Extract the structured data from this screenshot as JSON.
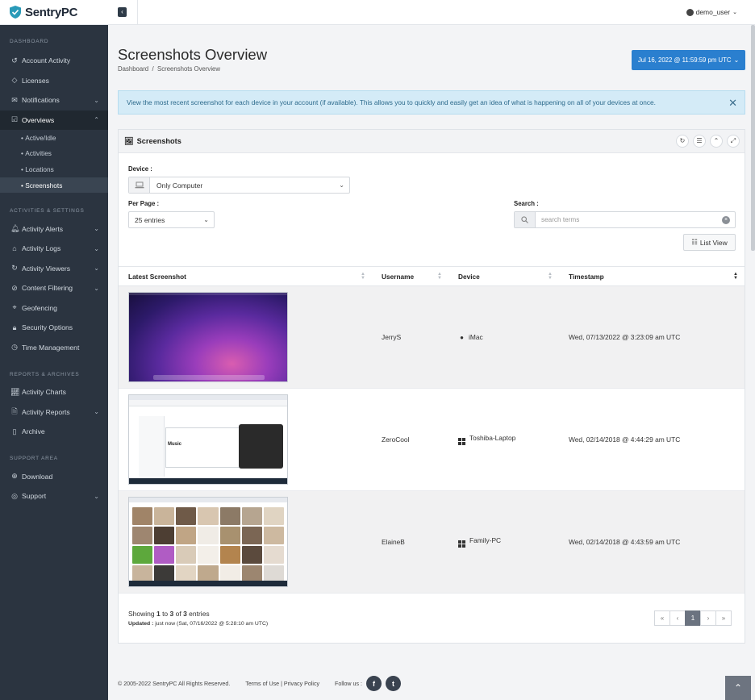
{
  "app": {
    "name": "SentryPC"
  },
  "header": {
    "username": "demo_user"
  },
  "sidebar": {
    "sections": [
      {
        "title": "DASHBOARD"
      },
      {
        "title": "ACTIVITIES & SETTINGS"
      },
      {
        "title": "REPORTS & ARCHIVES"
      },
      {
        "title": "SUPPORT AREA"
      }
    ],
    "items": {
      "account_activity": "Account Activity",
      "licenses": "Licenses",
      "notifications": "Notifications",
      "overviews": "Overviews",
      "active_idle": "Active/Idle",
      "activities": "Activities",
      "locations": "Locations",
      "screenshots": "Screenshots",
      "activity_alerts": "Activity Alerts",
      "activity_logs": "Activity Logs",
      "activity_viewers": "Activity Viewers",
      "content_filtering": "Content Filtering",
      "geofencing": "Geofencing",
      "security_options": "Security Options",
      "time_management": "Time Management",
      "activity_charts": "Activity Charts",
      "activity_reports": "Activity Reports",
      "archive": "Archive",
      "download": "Download",
      "support": "Support"
    }
  },
  "page": {
    "title": "Screenshots Overview",
    "breadcrumb": {
      "home": "Dashboard",
      "separator": "/",
      "current": "Screenshots Overview"
    },
    "date_button": "Jul 16, 2022 @ 11:59:59 pm UTC",
    "alert": "View the most recent screenshot for each device in your account (if available).  This allows you to quickly and easily get an idea of what is happening on all of your devices at once."
  },
  "card": {
    "title": "Screenshots",
    "device_label": "Device :",
    "device_value": "Only Computer",
    "per_page_label": "Per Page :",
    "per_page_value": "25 entries",
    "search_label": "Search :",
    "search_placeholder": "search terms",
    "list_view": "List View"
  },
  "table": {
    "headers": {
      "screenshot": "Latest Screenshot",
      "username": "Username",
      "device": "Device",
      "timestamp": "Timestamp"
    },
    "rows": [
      {
        "username": "JerryS",
        "device": "iMac",
        "os": "apple-icon",
        "timestamp": "Wed, 07/13/2022 @ 3:23:09 am UTC"
      },
      {
        "username": "ZeroCool",
        "device": "Toshiba-Laptop",
        "os": "windows-icon",
        "timestamp": "Wed, 02/14/2018 @ 4:44:29 am UTC"
      },
      {
        "username": "ElaineB",
        "device": "Family-PC",
        "os": "windows-icon",
        "timestamp": "Wed, 02/14/2018 @ 4:43:59 am UTC"
      }
    ],
    "screenshot_caption": "Music"
  },
  "pagination": {
    "showing_prefix": "Showing ",
    "start": "1",
    "to": " to ",
    "end": "3",
    "of": " of ",
    "total": "3",
    "suffix": " entries",
    "updated_label": "Updated :",
    "updated_value": " just now (Sat, 07/16/2022 @ 5:28:10 am UTC)",
    "current_page": "1"
  },
  "footer": {
    "copyright": "© 2005-2022 SentryPC All Rights Reserved.",
    "terms": "Terms of Use",
    "separator": " | ",
    "privacy": "Privacy Policy",
    "follow": "Follow us :"
  },
  "colors": {
    "accent": "#2a7fcf",
    "sidebar": "#2b3440",
    "alert_bg": "#d4ebf7"
  }
}
